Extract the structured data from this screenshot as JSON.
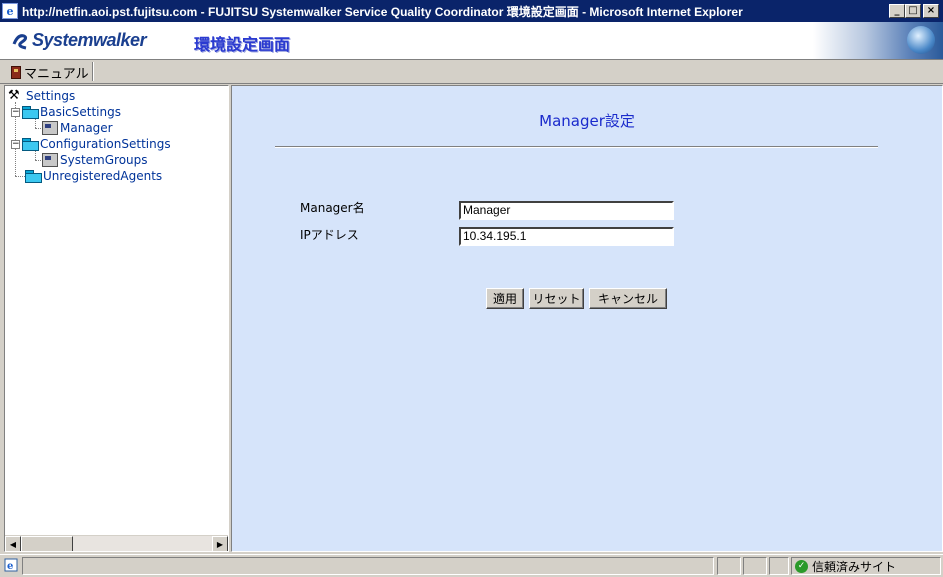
{
  "window": {
    "title": "http://netfin.aoi.pst.fujitsu.com - FUJITSU Systemwalker Service Quality Coordinator 環境設定画面 - Microsoft Internet Explorer",
    "minimize": "_",
    "maximize": "□",
    "close": "×"
  },
  "banner": {
    "logo": "Systemwalker",
    "app_title": "環境設定画面"
  },
  "toolbar": {
    "manual_label": "マニュアル"
  },
  "tree": {
    "root": "Settings",
    "basic": "BasicSettings",
    "manager": "Manager",
    "config": "ConfigurationSettings",
    "system_groups": "SystemGroups",
    "unregistered": "UnregisteredAgents"
  },
  "form": {
    "heading": "Manager設定",
    "manager_name_label": "Manager名",
    "manager_name_value": "Manager",
    "ip_label": "IPアドレス",
    "ip_value": "10.34.195.1",
    "apply_label": "適用",
    "reset_label": "リセット",
    "cancel_label": "キャンセル"
  },
  "statusbar": {
    "zone_label": "信頼済みサイト"
  },
  "colors": {
    "titlebar": "#0a246a",
    "content_bg": "#d6e4fa",
    "heading": "#1a2acc",
    "tree_link": "#003399"
  }
}
